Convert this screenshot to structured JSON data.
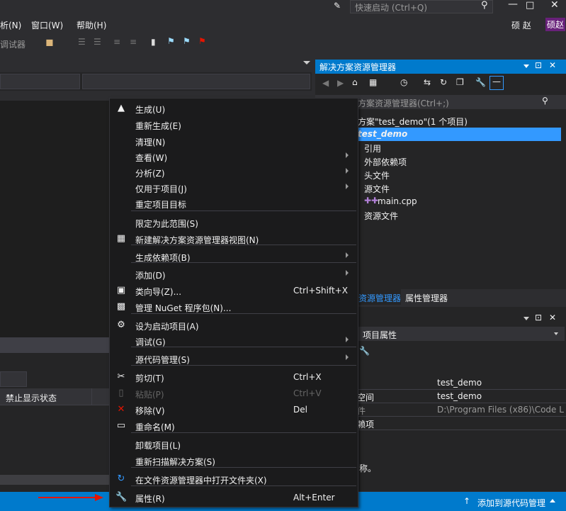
{
  "titlebar": {
    "quick_launch": "快速启动 (Ctrl+Q)",
    "user_name": "硕 赵",
    "user_badge": "硕赵"
  },
  "menubar": {
    "items": [
      "析(N)",
      "窗口(W)",
      "帮助(H)"
    ]
  },
  "toolbar": {
    "debugger_label": "调试器"
  },
  "left_panel": {
    "col_header": "禁止显示状态"
  },
  "solution_explorer": {
    "title": "解决方案资源管理器",
    "search_placeholder": "方案资源管理器(Ctrl+;)",
    "solution_label": "方案\"test_demo\"(1 个项目)",
    "project": "test_demo",
    "nodes": [
      "引用",
      "外部依赖项",
      "头文件",
      "源文件",
      "main.cpp",
      "资源文件"
    ],
    "tab_active": "资源管理器",
    "tab_other": "属性管理器"
  },
  "properties": {
    "object_label": "项目属性",
    "rows": [
      {
        "key": "",
        "value": "test_demo"
      },
      {
        "key": "空间",
        "value": "test_demo"
      },
      {
        "key": "件",
        "value": "D:\\Program Files (x86)\\Code L"
      },
      {
        "key": "赖项",
        "value": ""
      }
    ],
    "desc_fragment": "称。"
  },
  "context_menu": {
    "items": [
      {
        "label": "生成(U)",
        "shortcut": "",
        "icon": "build-icon",
        "submenu": false,
        "disabled": false
      },
      {
        "label": "重新生成(E)",
        "shortcut": "",
        "icon": "",
        "submenu": false,
        "disabled": false
      },
      {
        "label": "清理(N)",
        "shortcut": "",
        "icon": "",
        "submenu": false,
        "disabled": false
      },
      {
        "label": "查看(W)",
        "shortcut": "",
        "icon": "",
        "submenu": true,
        "disabled": false
      },
      {
        "label": "分析(Z)",
        "shortcut": "",
        "icon": "",
        "submenu": true,
        "disabled": false
      },
      {
        "label": "仅用于项目(J)",
        "shortcut": "",
        "icon": "",
        "submenu": true,
        "disabled": false
      },
      {
        "label": "重定项目目标",
        "shortcut": "",
        "icon": "",
        "submenu": false,
        "disabled": false
      },
      {
        "label": "限定为此范围(S)",
        "shortcut": "",
        "icon": "",
        "submenu": false,
        "disabled": false
      },
      {
        "label": "新建解决方案资源管理器视图(N)",
        "shortcut": "",
        "icon": "new-view-icon",
        "submenu": false,
        "disabled": false
      },
      {
        "label": "生成依赖项(B)",
        "shortcut": "",
        "icon": "",
        "submenu": true,
        "disabled": false
      },
      {
        "label": "添加(D)",
        "shortcut": "",
        "icon": "",
        "submenu": true,
        "disabled": false
      },
      {
        "label": "类向导(Z)...",
        "shortcut": "Ctrl+Shift+X",
        "icon": "class-wizard-icon",
        "submenu": false,
        "disabled": false
      },
      {
        "label": "管理 NuGet 程序包(N)...",
        "shortcut": "",
        "icon": "nuget-icon",
        "submenu": false,
        "disabled": false
      },
      {
        "label": "设为启动项目(A)",
        "shortcut": "",
        "icon": "gear-icon",
        "submenu": false,
        "disabled": false
      },
      {
        "label": "调试(G)",
        "shortcut": "",
        "icon": "",
        "submenu": true,
        "disabled": false
      },
      {
        "label": "源代码管理(S)",
        "shortcut": "",
        "icon": "",
        "submenu": true,
        "disabled": false
      },
      {
        "label": "剪切(T)",
        "shortcut": "Ctrl+X",
        "icon": "scissors-icon",
        "submenu": false,
        "disabled": false
      },
      {
        "label": "粘贴(P)",
        "shortcut": "Ctrl+V",
        "icon": "paste-icon",
        "submenu": false,
        "disabled": true
      },
      {
        "label": "移除(V)",
        "shortcut": "Del",
        "icon": "remove-icon",
        "submenu": false,
        "disabled": false
      },
      {
        "label": "重命名(M)",
        "shortcut": "",
        "icon": "rename-icon",
        "submenu": false,
        "disabled": false
      },
      {
        "label": "卸载项目(L)",
        "shortcut": "",
        "icon": "",
        "submenu": false,
        "disabled": false
      },
      {
        "label": "重新扫描解决方案(S)",
        "shortcut": "",
        "icon": "",
        "submenu": false,
        "disabled": false
      },
      {
        "label": "在文件资源管理器中打开文件夹(X)",
        "shortcut": "",
        "icon": "refresh-icon",
        "submenu": false,
        "disabled": false
      },
      {
        "label": "属性(R)",
        "shortcut": "Alt+Enter",
        "icon": "wrench-icon",
        "submenu": false,
        "disabled": false
      }
    ]
  },
  "statusbar": {
    "source_control": "添加到源代码管理"
  },
  "colors": {
    "accent": "#007acc",
    "selection": "#3399ff",
    "arrow": "#e51400"
  }
}
